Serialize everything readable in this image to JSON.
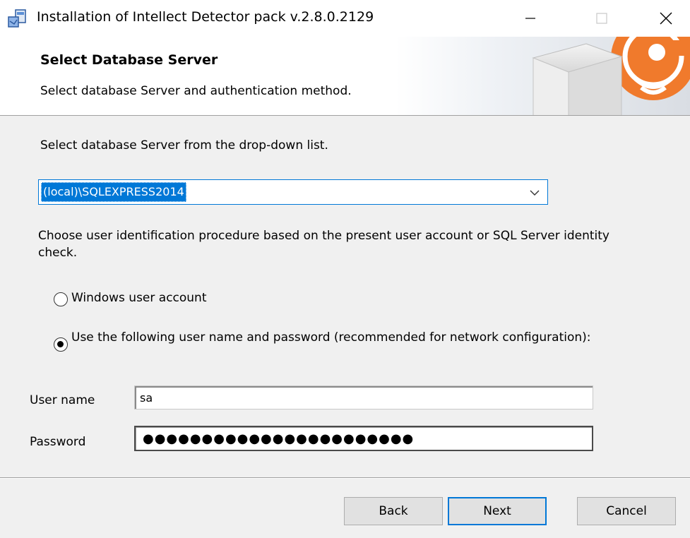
{
  "window": {
    "title": "Installation of Intellect Detector pack v.2.8.0.2129",
    "icon": "installer-icon",
    "controls": [
      "minimize-icon",
      "maximize-icon",
      "close-icon"
    ]
  },
  "banner": {
    "title": "Select Database Server",
    "subtitle": "Select database Server and authentication method."
  },
  "server": {
    "prompt": "Select database Server from the drop-down list.",
    "selected": "(local)\\SQLEXPRESS2014"
  },
  "auth": {
    "prompt": "Choose user identification procedure based on the present user account or SQL Server identity check.",
    "options": [
      {
        "label": "Windows user account",
        "checked": false
      },
      {
        "label": "Use the following user name and password (recommended for network configuration):",
        "checked": true
      }
    ]
  },
  "credentials": {
    "username_label": "User name",
    "username_value": "sa",
    "password_label": "Password",
    "password_value": "●●●●●●●●●●●●●●●●●●●●●●●"
  },
  "buttons": {
    "back": "Back",
    "next": "Next",
    "cancel": "Cancel"
  },
  "colors": {
    "accent": "#0078d7",
    "banner_orange": "#f07a2c"
  }
}
